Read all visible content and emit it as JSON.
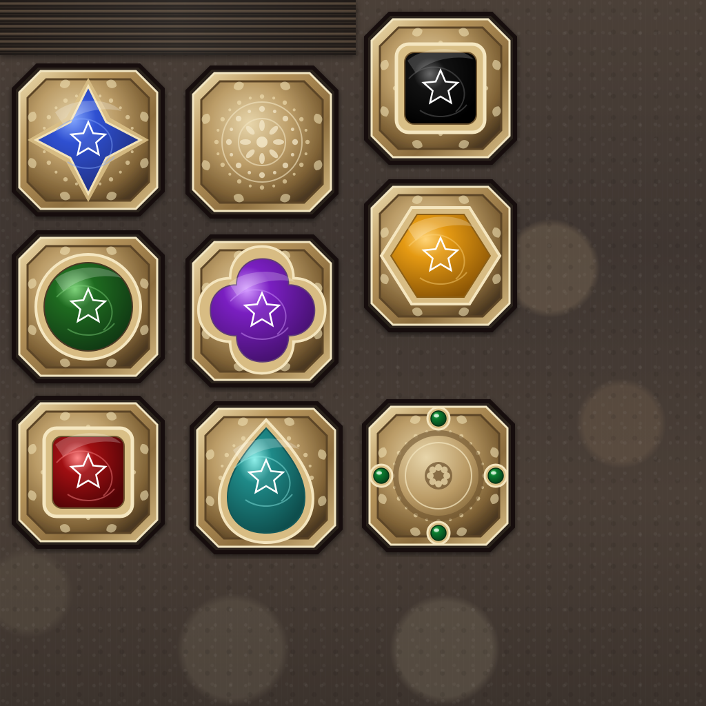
{
  "board": {
    "tiles": [
      {
        "name": "blue-star-gem-tile",
        "gem": "four-point-star",
        "color": "#2f50d1",
        "highlight": "#85a8ff",
        "dark": "#1f2e7d"
      },
      {
        "name": "empty-ornate-tile",
        "gem": "none",
        "color": "#c9b07a",
        "highlight": "#efe0b4",
        "dark": "#7d6337"
      },
      {
        "name": "black-square-gem-tile",
        "gem": "rounded-square",
        "color": "#111111",
        "highlight": "#6a6a6a",
        "dark": "#000000"
      },
      {
        "name": "green-round-gem-tile",
        "gem": "circle",
        "color": "#1f6b20",
        "highlight": "#7fd37b",
        "dark": "#103813"
      },
      {
        "name": "purple-quatrefoil-gem-tile",
        "gem": "quatrefoil",
        "color": "#7a1fc1",
        "highlight": "#d39aff",
        "dark": "#43106b"
      },
      {
        "name": "orange-hexagon-gem-tile",
        "gem": "hexagon",
        "color": "#e59a13",
        "highlight": "#ffd57a",
        "dark": "#8b5505"
      },
      {
        "name": "red-square-gem-tile",
        "gem": "rounded-square",
        "color": "#a00f12",
        "highlight": "#ff8888",
        "dark": "#520406"
      },
      {
        "name": "teal-drop-gem-tile",
        "gem": "teardrop",
        "color": "#1f8a88",
        "highlight": "#8ff0ea",
        "dark": "#0e4e4d"
      },
      {
        "name": "emerald-medallion-tile",
        "gem": "medallion",
        "color": "#0b7b2f",
        "highlight": "#6ee07e",
        "dark": "#04411a"
      }
    ]
  }
}
